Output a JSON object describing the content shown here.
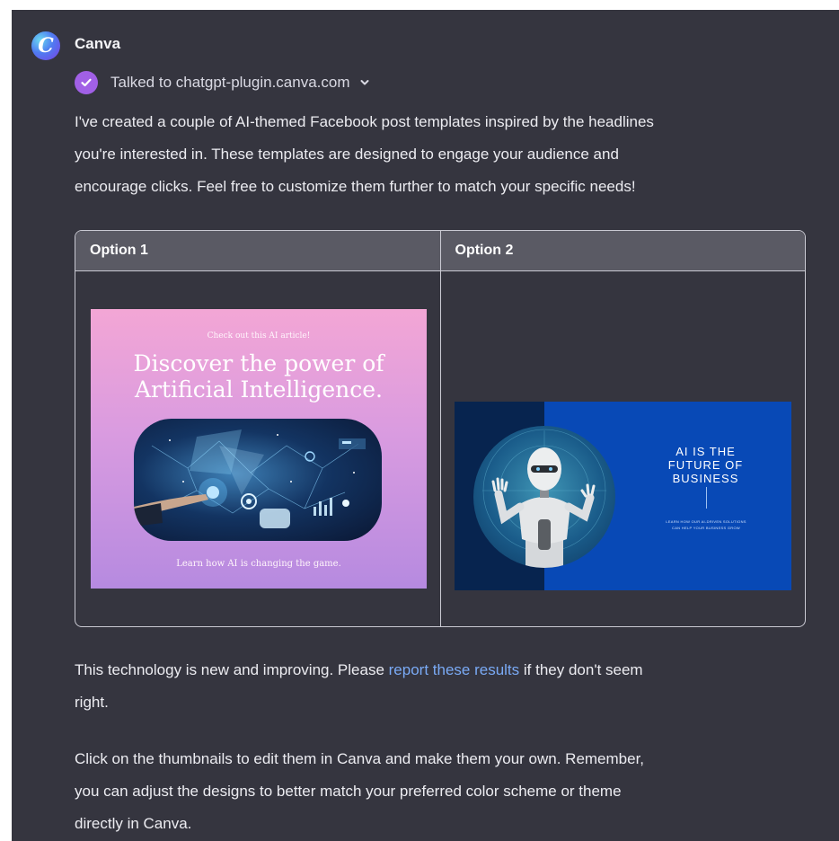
{
  "message": {
    "author": "Canva",
    "avatar_icon": "canva-logo-icon",
    "avatar_letter": "C",
    "plugin_action": "Talked to chatgpt-plugin.canva.com",
    "intro_lines": [
      "I've created a couple of AI-themed Facebook post templates inspired by the headlines",
      "you're interested in. These templates are designed to engage your audience and",
      "encourage clicks. Feel free to customize them further to match your specific needs!"
    ],
    "table": {
      "headers": [
        "Option 1",
        "Option 2"
      ],
      "option1": {
        "small_text": "Check out this AI article!",
        "title_lines": [
          "Discover the power of",
          "Artificial Intelligence."
        ],
        "bottom_text": "Learn how AI is changing the game."
      },
      "option2": {
        "title_lines": [
          "AI IS THE",
          "FUTURE OF",
          "BUSINESS"
        ],
        "sub_lines": [
          "LEARN HOW OUR AI-DRIVEN SOLUTIONS",
          "CAN HELP YOUR BUSINESS GROW"
        ]
      }
    },
    "disclaimer": {
      "before": "This technology is new and improving. Please ",
      "link": "report these results",
      "after_line1": " if they don't seem",
      "line2": "right."
    },
    "outro_lines": [
      "Click on the thumbnails to edit them in Canva and make them your own. Remember,",
      "you can adjust the designs to better match your preferred color scheme or theme",
      "directly in Canva."
    ]
  },
  "colors": {
    "background": "#35353f",
    "text": "#ececf1",
    "link": "#7aaaf5",
    "check_badge": "#a160e6",
    "table_header": "#5a5a64",
    "option2_blue": "#0849b6"
  },
  "icons": {
    "plugin_status": "check-circle-icon",
    "expand": "chevron-down-icon"
  }
}
